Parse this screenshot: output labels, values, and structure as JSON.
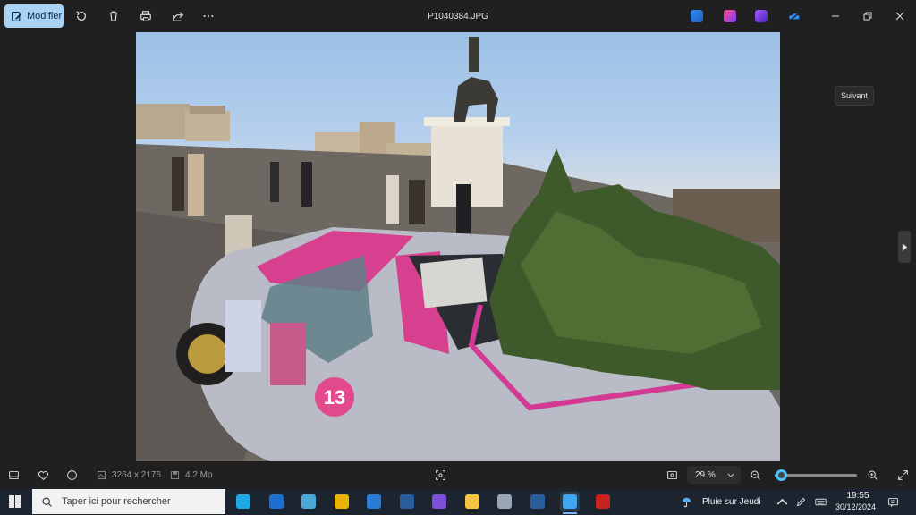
{
  "window": {
    "title": "P1040384.JPG"
  },
  "toolbar": {
    "edit_label": "Modifier",
    "icons": [
      "edit-icon",
      "rotate-icon",
      "delete-icon",
      "print-icon",
      "share-icon",
      "more-icon"
    ],
    "app_badges": [
      "designer-icon",
      "clipchamp-icon",
      "photos-app-icon",
      "onedrive-icon"
    ],
    "window_controls": [
      "minimize-icon",
      "restore-icon",
      "close-icon"
    ]
  },
  "photo": {
    "description_colors": {
      "sky": "#a9c6e6",
      "car_pink": "#d6408e",
      "car_silver": "#b9bcc6",
      "tree": "#3f5a2a",
      "cobblestone": "#6c6560"
    },
    "sticker_number": "13"
  },
  "tooltip": {
    "next": "Suivant"
  },
  "infobar": {
    "dimensions": "3264 x 2176",
    "file_size": "4.2 Mo",
    "zoom_label": "29 %",
    "zoom_fraction": 0.08
  },
  "taskbar": {
    "search_placeholder": "Taper ici pour rechercher",
    "weather": "Pluie sur Jeudi",
    "time": "19:55",
    "date": "30/12/2024",
    "accent": "#7db4ff",
    "apps": [
      {
        "name": "edge",
        "color": "#1fa7e3"
      },
      {
        "name": "outlook",
        "color": "#1f6fd1"
      },
      {
        "name": "notepad",
        "color": "#4aa8d6"
      },
      {
        "name": "chrome",
        "color": "#e9b300"
      },
      {
        "name": "store",
        "color": "#2a7ad6"
      },
      {
        "name": "app-vpn",
        "color": "#2a5d9c"
      },
      {
        "name": "onenote-like",
        "color": "#7b4fd6"
      },
      {
        "name": "file-explorer",
        "color": "#f4c542"
      },
      {
        "name": "notepad2",
        "color": "#9aa6b5"
      },
      {
        "name": "app-vpn2",
        "color": "#2a5d9c"
      },
      {
        "name": "photos",
        "color": "#3fa6f0"
      },
      {
        "name": "filezilla",
        "color": "#c8211f"
      }
    ]
  }
}
